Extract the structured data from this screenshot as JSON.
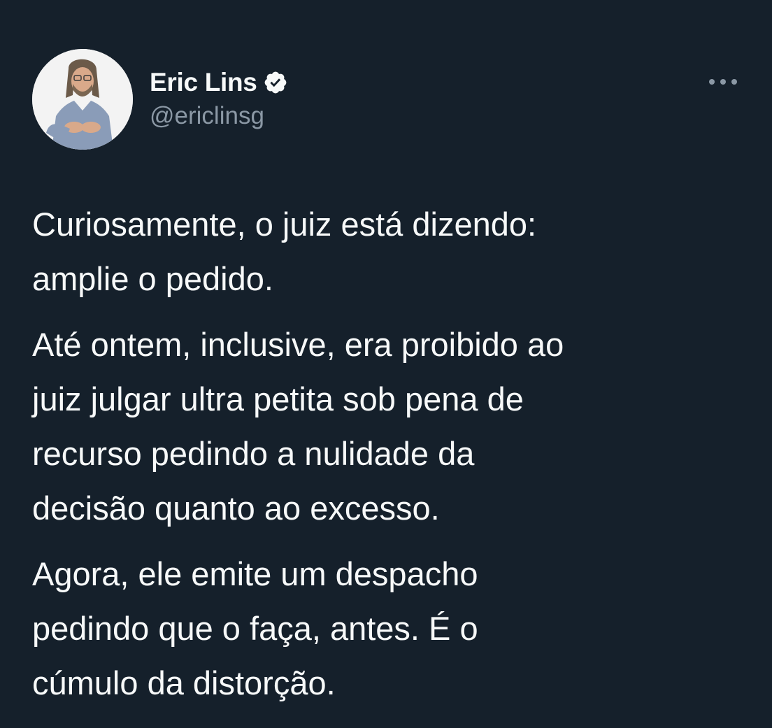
{
  "author": {
    "display_name": "Eric Lins",
    "handle": "@ericlinsg",
    "verified": true,
    "avatar": "avatar"
  },
  "icons": {
    "verified": "verified-badge-icon",
    "more": "more-options-icon"
  },
  "colors": {
    "background": "#15202b",
    "text": "#f7f9f9",
    "secondary_text": "#8b98a5"
  },
  "tweet": {
    "paragraphs": [
      {
        "lines": [
          "Curiosamente, o juiz está dizendo:",
          "amplie o pedido."
        ]
      },
      {
        "lines": [
          "Até ontem, inclusive, era proibido ao",
          "juiz julgar ultra petita sob pena de",
          "recurso pedindo a nulidade da",
          "decisão quanto ao excesso."
        ]
      },
      {
        "lines": [
          "Agora, ele emite um despacho",
          "pedindo que o faça, antes. É o",
          "cúmulo da distorção."
        ]
      }
    ]
  }
}
